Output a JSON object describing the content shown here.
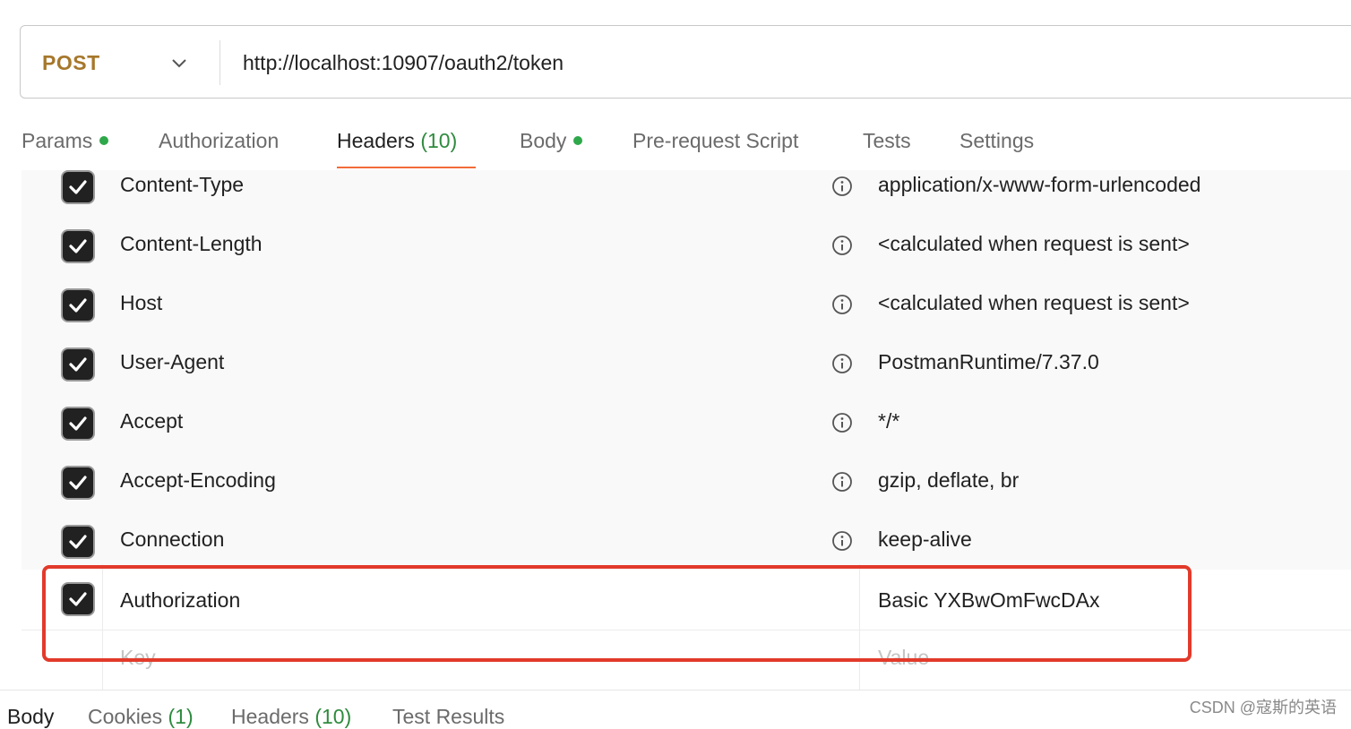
{
  "request": {
    "method": "POST",
    "url": "http://localhost:10907/oauth2/token"
  },
  "tabs": [
    {
      "label": "Params",
      "dot": true
    },
    {
      "label": "Authorization"
    },
    {
      "label": "Headers",
      "count": "(10)",
      "active": true
    },
    {
      "label": "Body",
      "dot": true
    },
    {
      "label": "Pre-request Script"
    },
    {
      "label": "Tests"
    },
    {
      "label": "Settings"
    }
  ],
  "headers": [
    {
      "key": "Content-Type",
      "value": "application/x-www-form-urlencoded",
      "checked": true,
      "auto": true
    },
    {
      "key": "Content-Length",
      "value": "<calculated when request is sent>",
      "checked": true,
      "auto": true
    },
    {
      "key": "Host",
      "value": "<calculated when request is sent>",
      "checked": true,
      "auto": true
    },
    {
      "key": "User-Agent",
      "value": "PostmanRuntime/7.37.0",
      "checked": true,
      "auto": true
    },
    {
      "key": "Accept",
      "value": "*/*",
      "checked": true,
      "auto": true
    },
    {
      "key": "Accept-Encoding",
      "value": "gzip, deflate, br",
      "checked": true,
      "auto": true
    },
    {
      "key": "Connection",
      "value": "keep-alive",
      "checked": true,
      "auto": true
    },
    {
      "key": "Authorization",
      "value": "Basic YXBwOmFwcDAx",
      "checked": true,
      "auto": false
    }
  ],
  "new_row": {
    "key_placeholder": "Key",
    "value_placeholder": "Value"
  },
  "response_tabs": [
    {
      "label": "Body",
      "active": true
    },
    {
      "label": "Cookies",
      "count": "(1)"
    },
    {
      "label": "Headers",
      "count": "(10)"
    },
    {
      "label": "Test Results"
    }
  ],
  "watermark": "CSDN @寇斯的英语",
  "colors": {
    "method": "#a6772b",
    "active_underline": "#f26b3a",
    "dot": "#2ea84a",
    "highlight": "#e23a2b",
    "count": "#2e8b3e"
  }
}
